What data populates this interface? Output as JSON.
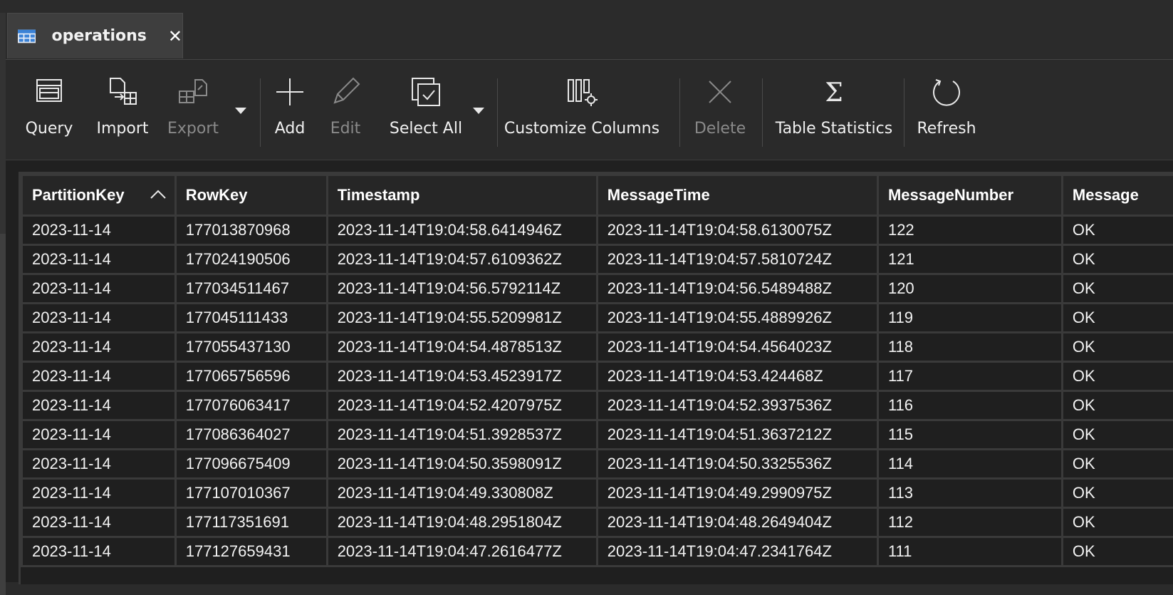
{
  "tab": {
    "title": "operations",
    "close_symbol": "✕",
    "icon": "table-icon"
  },
  "toolbar": {
    "query": "Query",
    "import": "Import",
    "export": "Export",
    "add": "Add",
    "edit": "Edit",
    "select_all": "Select All",
    "customize_columns": "Customize Columns",
    "delete": "Delete",
    "table_statistics": "Table Statistics",
    "refresh": "Refresh"
  },
  "grid": {
    "sorted_column": "PartitionKey",
    "sort_direction": "ascending",
    "columns": [
      "PartitionKey",
      "RowKey",
      "Timestamp",
      "MessageTime",
      "MessageNumber",
      "Message"
    ],
    "rows": [
      [
        "2023-11-14",
        "177013870968",
        "2023-11-14T19:04:58.6414946Z",
        "2023-11-14T19:04:58.6130075Z",
        "122",
        "OK"
      ],
      [
        "2023-11-14",
        "177024190506",
        "2023-11-14T19:04:57.6109362Z",
        "2023-11-14T19:04:57.5810724Z",
        "121",
        "OK"
      ],
      [
        "2023-11-14",
        "177034511467",
        "2023-11-14T19:04:56.5792114Z",
        "2023-11-14T19:04:56.5489488Z",
        "120",
        "OK"
      ],
      [
        "2023-11-14",
        "177045111433",
        "2023-11-14T19:04:55.5209981Z",
        "2023-11-14T19:04:55.4889926Z",
        "119",
        "OK"
      ],
      [
        "2023-11-14",
        "177055437130",
        "2023-11-14T19:04:54.4878513Z",
        "2023-11-14T19:04:54.4564023Z",
        "118",
        "OK"
      ],
      [
        "2023-11-14",
        "177065756596",
        "2023-11-14T19:04:53.4523917Z",
        "2023-11-14T19:04:53.424468Z",
        "117",
        "OK"
      ],
      [
        "2023-11-14",
        "177076063417",
        "2023-11-14T19:04:52.4207975Z",
        "2023-11-14T19:04:52.3937536Z",
        "116",
        "OK"
      ],
      [
        "2023-11-14",
        "177086364027",
        "2023-11-14T19:04:51.3928537Z",
        "2023-11-14T19:04:51.3637212Z",
        "115",
        "OK"
      ],
      [
        "2023-11-14",
        "177096675409",
        "2023-11-14T19:04:50.3598091Z",
        "2023-11-14T19:04:50.3325536Z",
        "114",
        "OK"
      ],
      [
        "2023-11-14",
        "177107010367",
        "2023-11-14T19:04:49.330808Z",
        "2023-11-14T19:04:49.2990975Z",
        "113",
        "OK"
      ],
      [
        "2023-11-14",
        "177117351691",
        "2023-11-14T19:04:48.2951804Z",
        "2023-11-14T19:04:48.2649404Z",
        "112",
        "OK"
      ],
      [
        "2023-11-14",
        "177127659431",
        "2023-11-14T19:04:47.2616477Z",
        "2023-11-14T19:04:47.2341764Z",
        "111",
        "OK"
      ]
    ]
  }
}
